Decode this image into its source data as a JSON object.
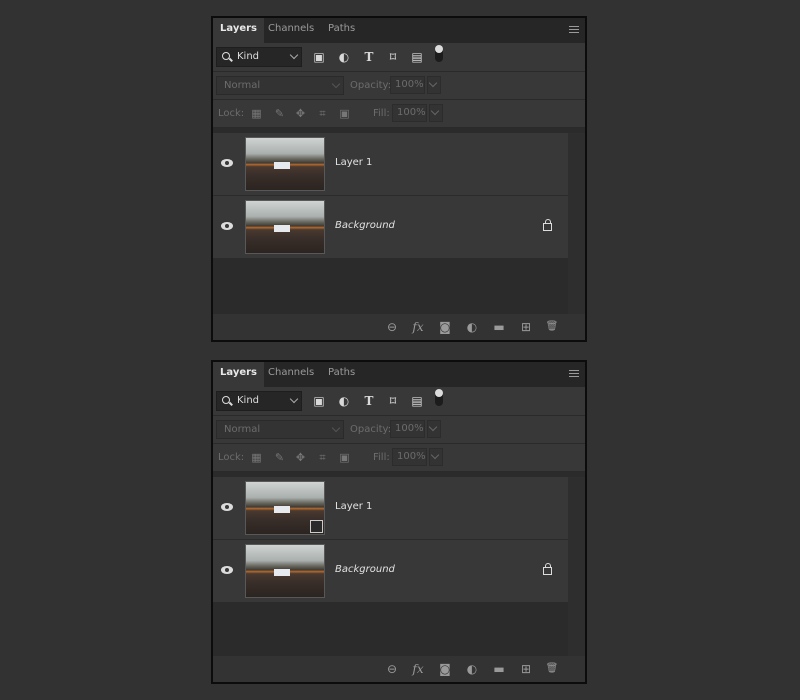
{
  "panels": [
    {
      "tabs": [
        {
          "label": "Layers",
          "active": true
        },
        {
          "label": "Channels",
          "active": false
        },
        {
          "label": "Paths",
          "active": false
        }
      ],
      "filter": {
        "kind_label": "Kind"
      },
      "blend_mode": "Normal",
      "opacity_label": "Opacity:",
      "opacity_value": "100%",
      "lock_label": "Lock:",
      "fill_label": "Fill:",
      "fill_value": "100%",
      "layers": [
        {
          "name": "Layer 1",
          "italic": false,
          "locked": false,
          "smart_object": false
        },
        {
          "name": "Background",
          "italic": true,
          "locked": true,
          "smart_object": false
        }
      ]
    },
    {
      "tabs": [
        {
          "label": "Layers",
          "active": true
        },
        {
          "label": "Channels",
          "active": false
        },
        {
          "label": "Paths",
          "active": false
        }
      ],
      "filter": {
        "kind_label": "Kind"
      },
      "blend_mode": "Normal",
      "opacity_label": "Opacity:",
      "opacity_value": "100%",
      "lock_label": "Lock:",
      "fill_label": "Fill:",
      "fill_value": "100%",
      "layers": [
        {
          "name": "Layer 1",
          "italic": false,
          "locked": false,
          "smart_object": true
        },
        {
          "name": "Background",
          "italic": true,
          "locked": true,
          "smart_object": false
        }
      ]
    }
  ],
  "footer_icons": [
    "link-layers-icon",
    "fx-icon",
    "add-mask-icon",
    "adjustment-layer-icon",
    "new-group-icon",
    "new-layer-icon",
    "delete-icon"
  ],
  "footer_glyphs": {
    "fx": "fx",
    "mask": "◙",
    "adjust": "◐",
    "group": "▬",
    "new": "⊞",
    "trash": "🗑",
    "link": "⊖"
  }
}
